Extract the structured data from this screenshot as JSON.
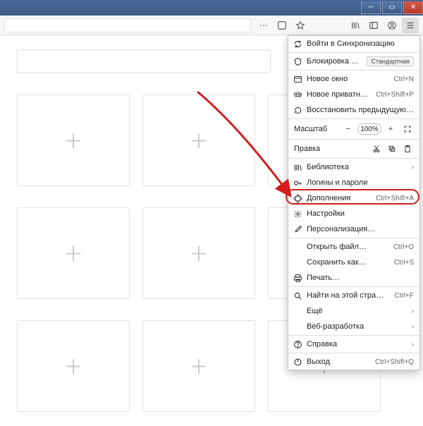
{
  "window": {
    "title": ""
  },
  "toolbar": {
    "icons": {
      "more": "more-icon",
      "reader": "reader-icon",
      "star": "star-icon",
      "library": "library-icon",
      "sidebar": "sidebar-icon",
      "account": "account-icon",
      "menu": "menu-icon"
    }
  },
  "menu": {
    "sync": "Войти в Синхронизацию",
    "blocking": {
      "label": "Блокировка содержимого",
      "badge": "Стандартная"
    },
    "new_window": {
      "label": "Новое окно",
      "shortcut": "Ctrl+N"
    },
    "new_private": {
      "label": "Новое приватное окно",
      "shortcut": "Ctrl+Shift+P"
    },
    "restore": "Восстановить предыдущую сессию",
    "zoom": {
      "label": "Масштаб",
      "value": "100%"
    },
    "edit": {
      "label": "Правка"
    },
    "library": "Библиотека",
    "logins": "Логины и пароли",
    "addons": {
      "label": "Дополнения",
      "shortcut": "Ctrl+Shift+A"
    },
    "settings": "Настройки",
    "customize": "Персонализация…",
    "open_file": {
      "label": "Открыть файл…",
      "shortcut": "Ctrl+O"
    },
    "save_as": {
      "label": "Сохранить как…",
      "shortcut": "Ctrl+S"
    },
    "print": "Печать…",
    "find": {
      "label": "Найти на этой странице…",
      "shortcut": "Ctrl+F"
    },
    "more": "Ещё",
    "webdev": "Веб-разработка",
    "help": "Справка",
    "exit": {
      "label": "Выход",
      "shortcut": "Ctrl+Shift+Q"
    }
  }
}
